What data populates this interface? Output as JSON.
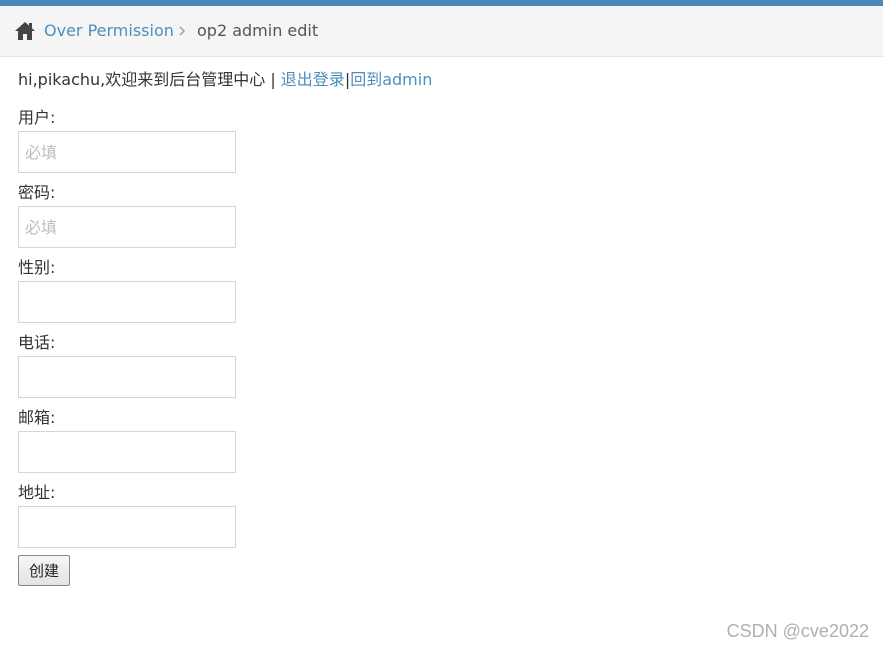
{
  "breadcrumb": {
    "home_icon": "home-icon",
    "link_label": "Over Permission",
    "separator_icon": "chevron-right-icon",
    "current_label": "op2 admin edit"
  },
  "welcome": {
    "greeting": "hi,pikachu,欢迎来到后台管理中心",
    "separator1": " | ",
    "logout_label": "退出登录",
    "separator2": "|",
    "back_label": "回到admin"
  },
  "form": {
    "fields": [
      {
        "label": "用户:",
        "placeholder": "必填",
        "value": ""
      },
      {
        "label": "密码:",
        "placeholder": "必填",
        "value": ""
      },
      {
        "label": "性别:",
        "placeholder": "",
        "value": ""
      },
      {
        "label": "电话:",
        "placeholder": "",
        "value": ""
      },
      {
        "label": "邮箱:",
        "placeholder": "",
        "value": ""
      },
      {
        "label": "地址:",
        "placeholder": "",
        "value": ""
      }
    ],
    "submit_label": "创建"
  },
  "watermark": "CSDN @cve2022",
  "colors": {
    "accent_bar": "#4a8ab8",
    "link": "#4c8fbd"
  }
}
